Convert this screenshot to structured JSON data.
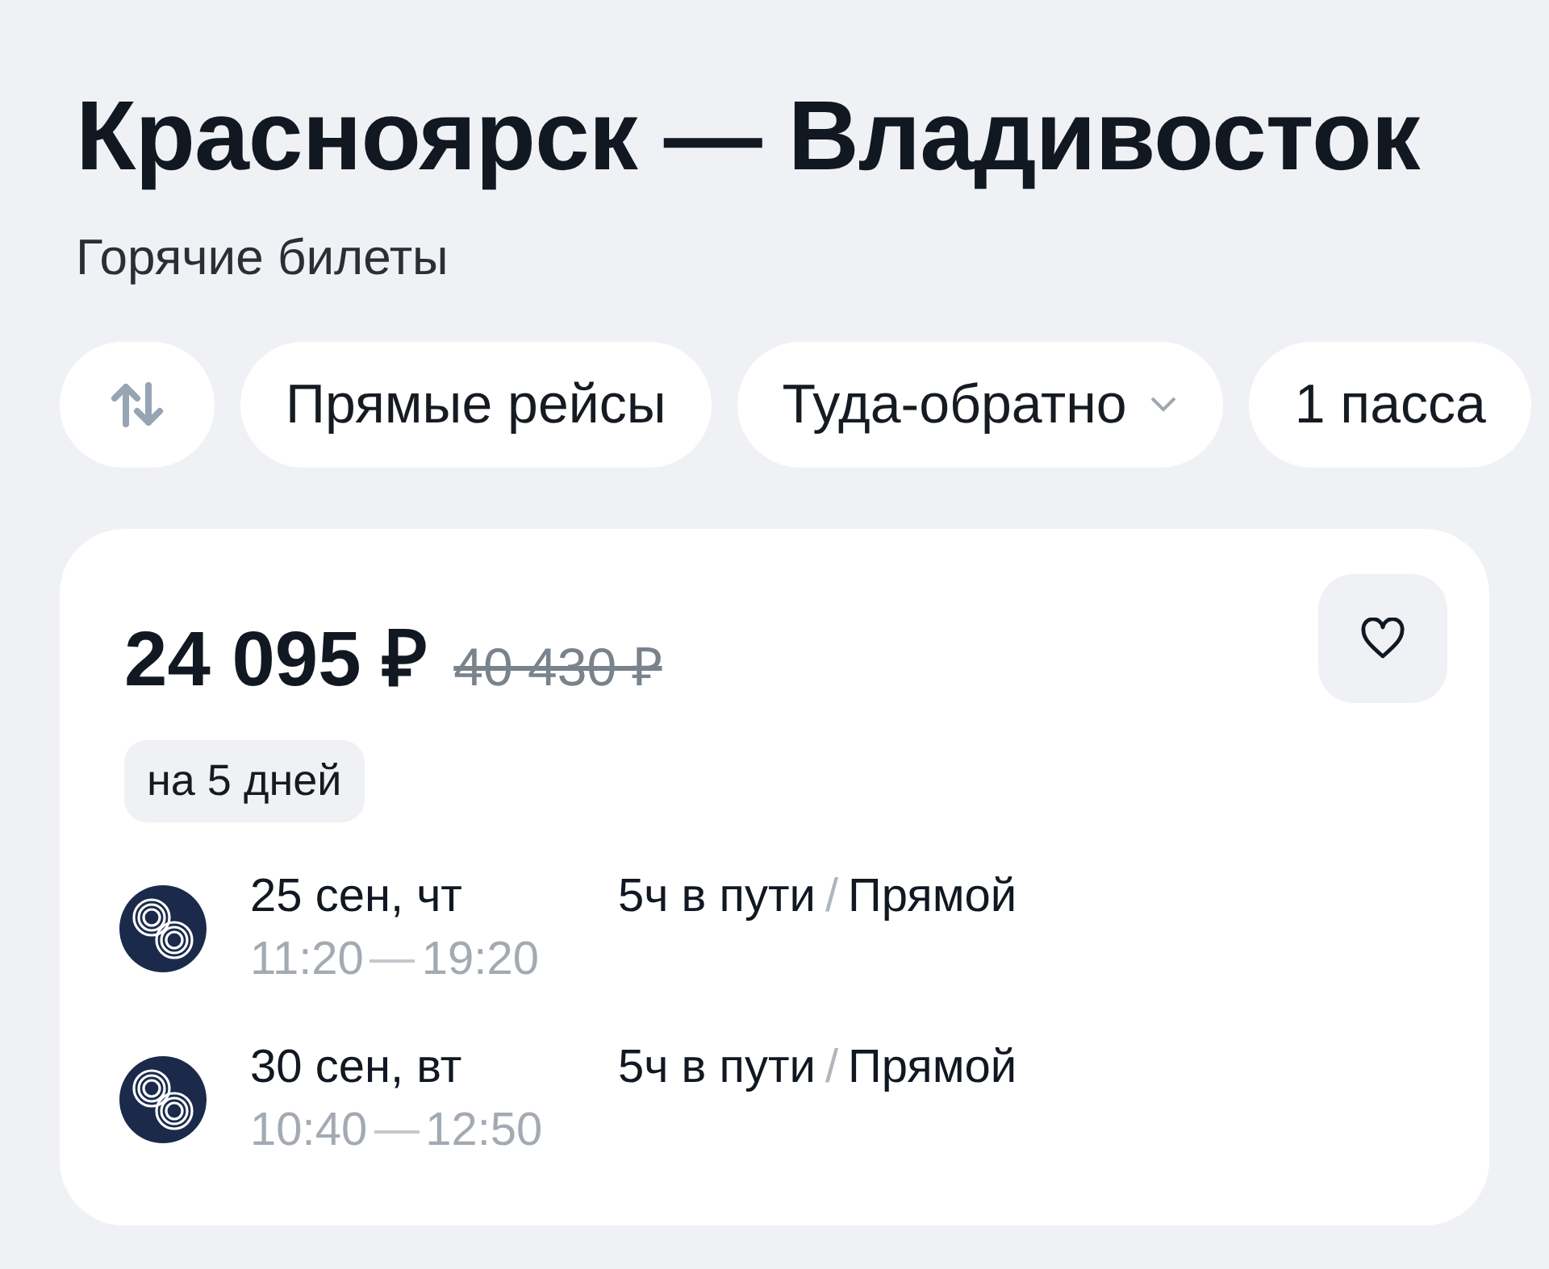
{
  "title": "Красноярск — Владивосток",
  "subtitle": "Горячие билеты",
  "filters": [
    {
      "kind": "swap"
    },
    {
      "kind": "chip",
      "label": "Прямые рейсы"
    },
    {
      "kind": "dropdown",
      "label": "Туда-обратно"
    },
    {
      "kind": "chip",
      "label": "1 пасса"
    }
  ],
  "offer": {
    "price": "24 095 ₽",
    "old_price": "40 430 ₽",
    "stay": "на 5 дней",
    "legs": [
      {
        "date": "25 сен, чт",
        "depart": "11:20",
        "arrive": "19:20",
        "duration": "5ч в пути",
        "separator": "/",
        "type": "Прямой"
      },
      {
        "date": "30 сен, вт",
        "depart": "10:40",
        "arrive": "12:50",
        "duration": "5ч в пути",
        "separator": "/",
        "type": "Прямой"
      }
    ]
  }
}
